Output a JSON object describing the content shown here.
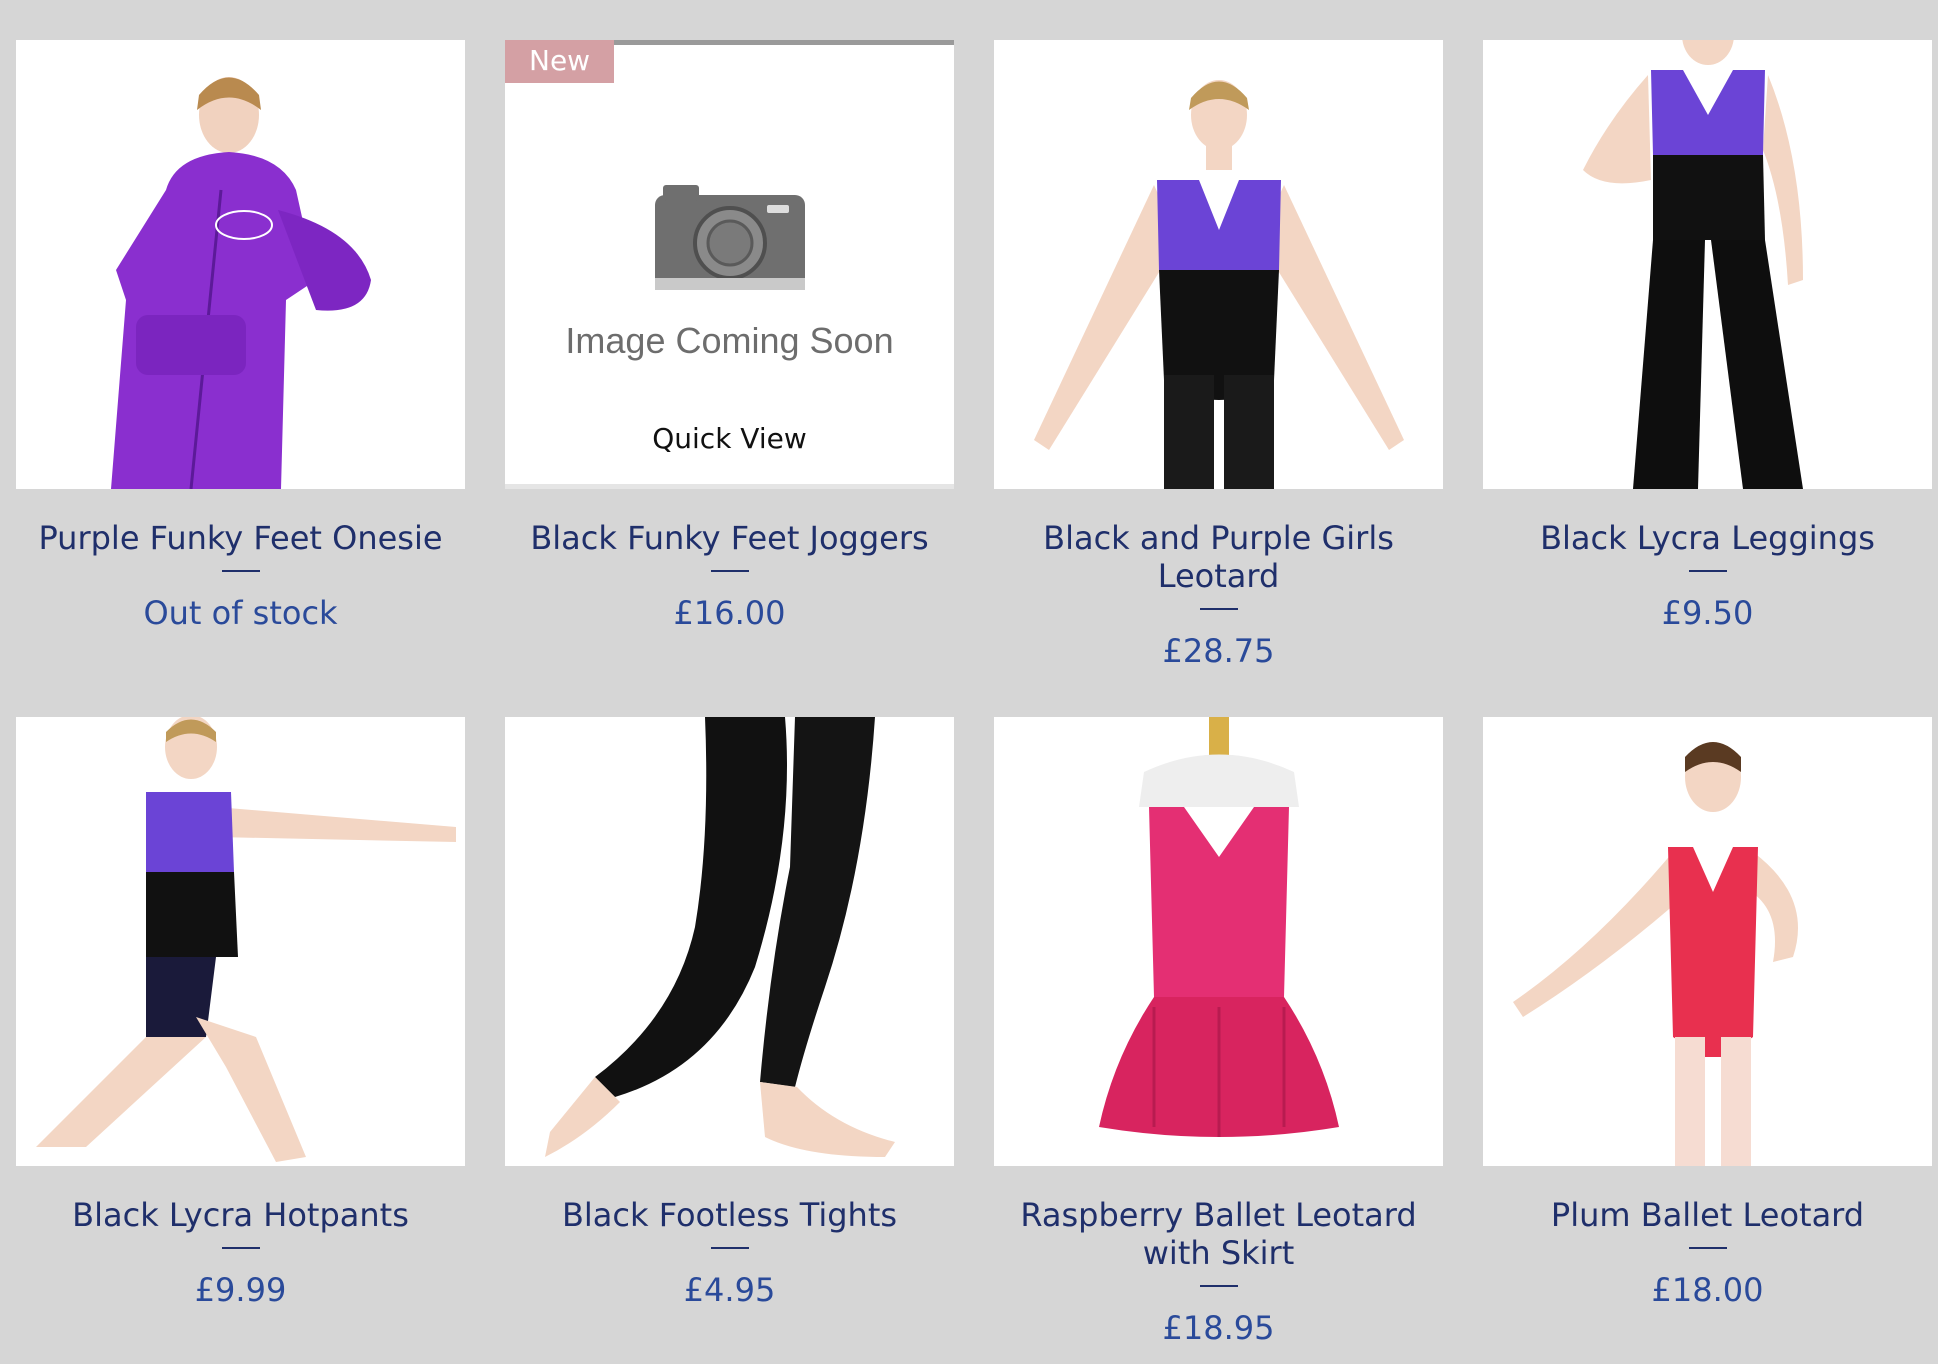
{
  "colors": {
    "background": "#d6d6d6",
    "title": "#1f2f6b",
    "price": "#2a4a9a",
    "ribbon": "#d4a0a4"
  },
  "products": [
    {
      "title": "Purple Funky Feet Onesie",
      "price": "Out of stock",
      "image": "purple-onesie-photo"
    },
    {
      "title": "Black Funky Feet Joggers",
      "price": "£16.00",
      "image": "image-coming-soon",
      "ribbon": "New",
      "placeholder_text": "Image Coming Soon",
      "quick_view": "Quick View"
    },
    {
      "title": "Black and Purple Girls Leotard",
      "price": "£28.75",
      "image": "black-purple-leotard-photo"
    },
    {
      "title": "Black Lycra Leggings",
      "price": "£9.50",
      "image": "black-leggings-photo"
    },
    {
      "title": "Black Lycra Hotpants",
      "price": "£9.99",
      "image": "black-hotpants-photo"
    },
    {
      "title": "Black Footless Tights",
      "price": "£4.95",
      "image": "black-tights-photo"
    },
    {
      "title": "Raspberry Ballet Leotard with Skirt",
      "price": "£18.95",
      "image": "raspberry-leotard-photo"
    },
    {
      "title": "Plum Ballet Leotard",
      "price": "£18.00",
      "image": "plum-leotard-photo"
    }
  ]
}
